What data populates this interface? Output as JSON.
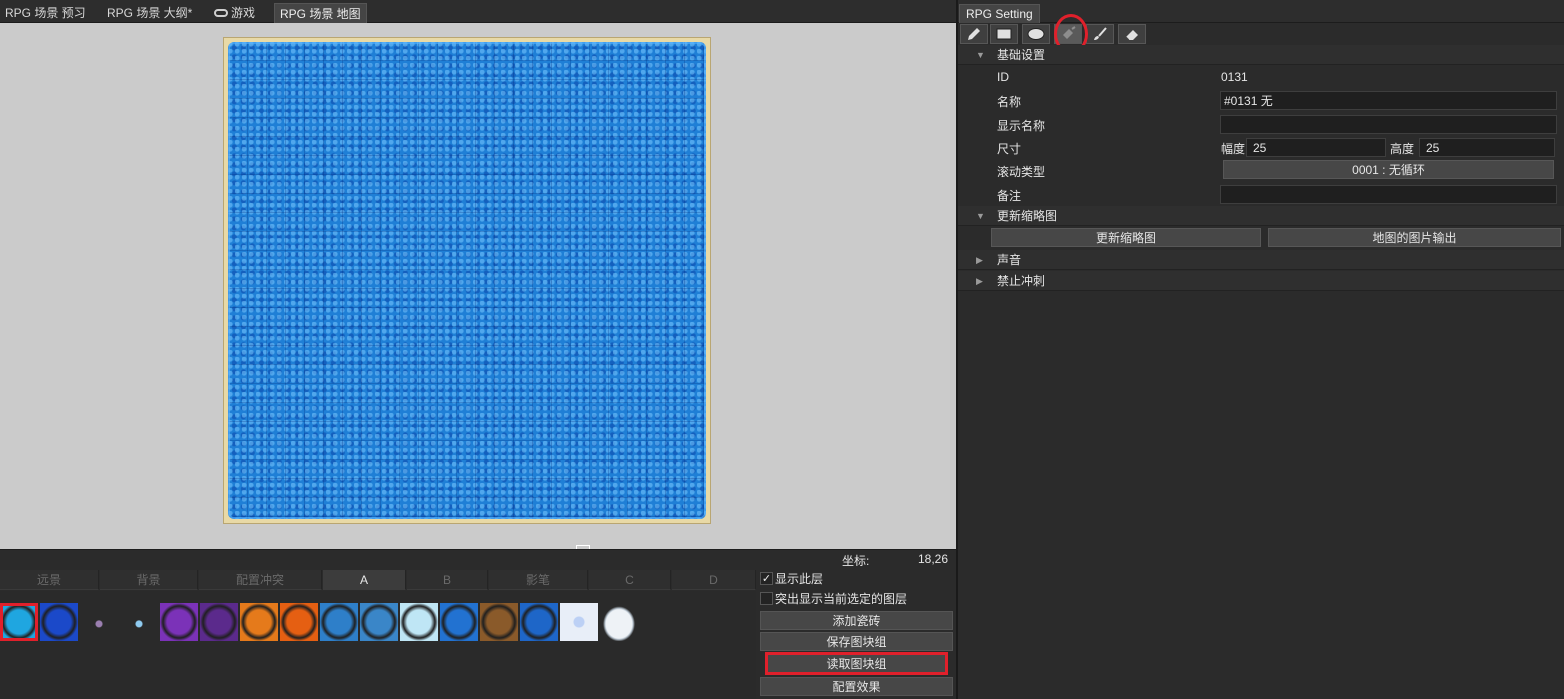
{
  "editor_tabs": [
    "RPG 场景 预习",
    "RPG 场景 大纲*",
    "游戏",
    "RPG 场景 地图"
  ],
  "status": {
    "coord_label": "坐标:",
    "coord_value": "18,26"
  },
  "layer_tabs": [
    "远景",
    "背景",
    "配置冲突",
    "A",
    "B",
    "影笔",
    "C",
    "D"
  ],
  "active_layer_tab": "A",
  "tiles": [
    {
      "name": "water-ring-tile",
      "color": "#1fa6e0"
    },
    {
      "name": "blue-water-tile",
      "color": "#1b49c9"
    },
    {
      "name": "small-crystal-tile",
      "color": "#9b7fb0"
    },
    {
      "name": "water-drop-tile",
      "color": "#8fcbf0"
    },
    {
      "name": "purple-pool-tile",
      "color": "#7b32b8"
    },
    {
      "name": "purple-vine-tile",
      "color": "#5b2a8c"
    },
    {
      "name": "lava-cracked-tile",
      "color": "#e57a1b"
    },
    {
      "name": "lava-pool-tile",
      "color": "#e55f12"
    },
    {
      "name": "sand-water-tile",
      "color": "#2e7fc9"
    },
    {
      "name": "rock-water-tile",
      "color": "#3a86c8"
    },
    {
      "name": "ice-circle-tile",
      "color": "#bfe6f5"
    },
    {
      "name": "whirlpool-tile",
      "color": "#2272d1"
    },
    {
      "name": "dirt-hole-tile",
      "color": "#8a5a2a"
    },
    {
      "name": "waterfall-tile",
      "color": "#1e66c8"
    },
    {
      "name": "white-crystal-tile",
      "color": "#e8eef8"
    },
    {
      "name": "cloud-tile",
      "color": "#eef2f6"
    }
  ],
  "layer_options": {
    "show_layer": "显示此层",
    "highlight_layer": "突出显示当前选定的图层",
    "add_tile": "添加瓷砖",
    "save_group": "保存图块组",
    "load_group": "读取图块组",
    "effects": "配置效果"
  },
  "right_panel": {
    "tab": "RPG Setting",
    "tools": [
      "pencil-icon",
      "rectangle-icon",
      "ellipse-icon",
      "fill-bucket-icon",
      "brush-icon",
      "eraser-icon"
    ],
    "section_basic": "基础设置",
    "id_label": "ID",
    "id_value": "0131",
    "name_label": "名称",
    "name_value": "#0131 无",
    "display_name_label": "显示名称",
    "display_name_value": "",
    "size_label": "尺寸",
    "width_label": "幅度",
    "width_value": "25",
    "height_label": "高度",
    "height_value": "25",
    "scroll_label": "滚动类型",
    "scroll_value": "0001 : 无循环",
    "note_label": "备注",
    "note_value": "",
    "section_thumb": "更新缩略图",
    "update_thumb_btn": "更新缩略图",
    "export_btn": "地图的图片输出",
    "section_sound": "声音",
    "section_dash": "禁止冲刺"
  }
}
